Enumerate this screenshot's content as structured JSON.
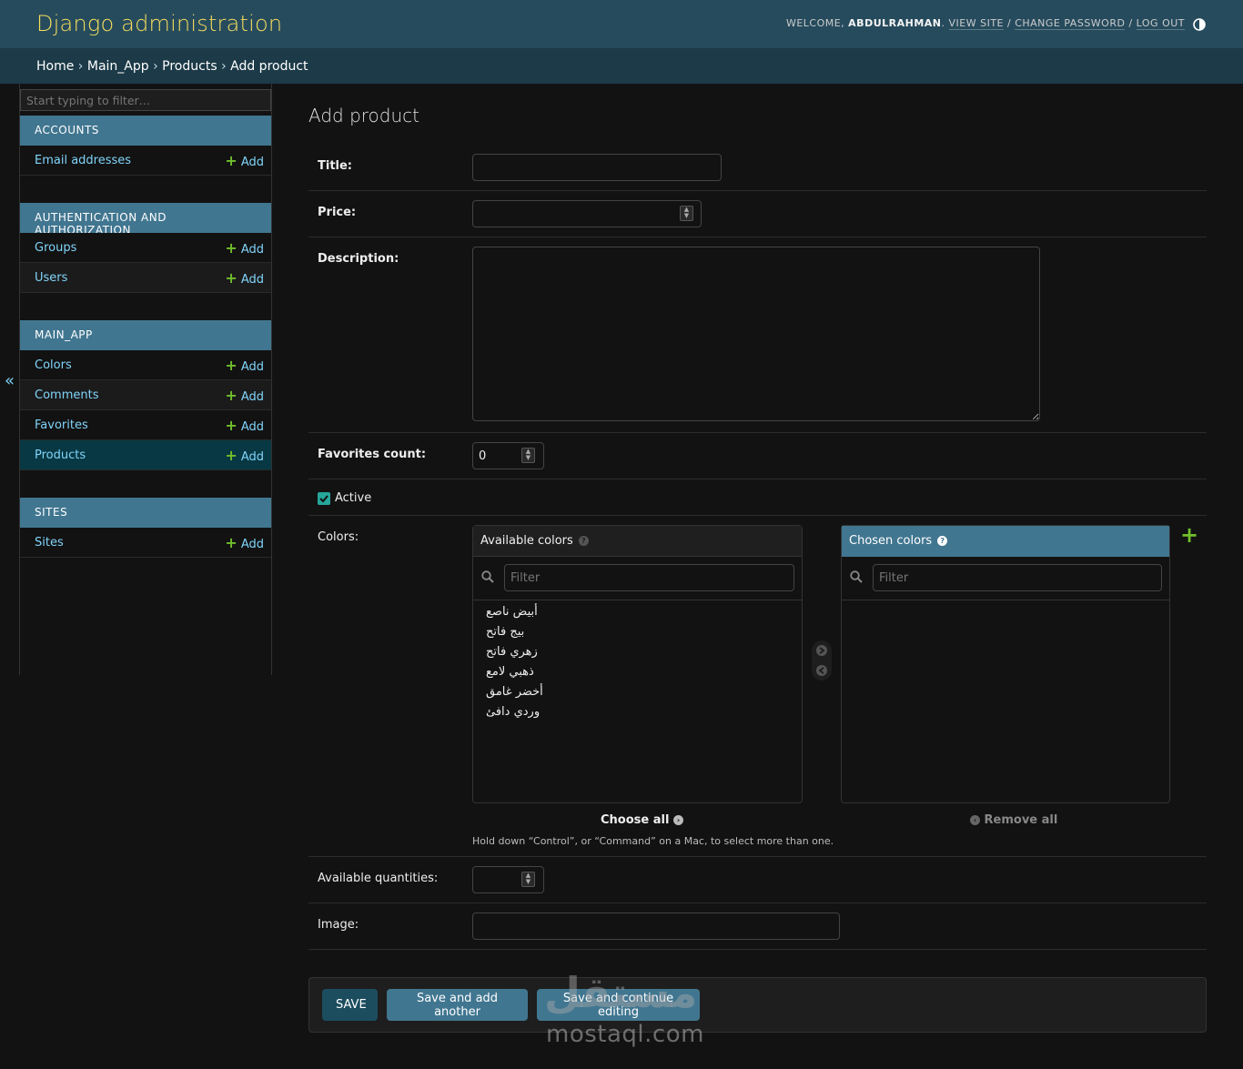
{
  "header": {
    "brand": "Django administration",
    "welcome": "WELCOME, ",
    "username": "ABDULRAHMAN",
    "view_site": "VIEW SITE",
    "change_password": "CHANGE PASSWORD",
    "log_out": "LOG OUT",
    "theme_icon": "contrast-icon"
  },
  "breadcrumb": {
    "home": "Home",
    "app": "Main_App",
    "model": "Products",
    "current": "Add product",
    "separator": "›"
  },
  "sidebar": {
    "filter_placeholder": "Start typing to filter…",
    "collapse_glyph": "«",
    "add_label": "Add",
    "modules": [
      {
        "caption": "ACCOUNTS",
        "models": [
          "Email addresses"
        ]
      },
      {
        "caption": "AUTHENTICATION AND AUTHORIZATION",
        "models": [
          "Groups",
          "Users"
        ]
      },
      {
        "caption": "MAIN_APP",
        "models": [
          "Colors",
          "Comments",
          "Favorites",
          "Products"
        ]
      },
      {
        "caption": "SITES",
        "models": [
          "Sites"
        ]
      }
    ],
    "selected_model": "Products"
  },
  "form": {
    "title": "Add product",
    "fields": {
      "title_label": "Title:",
      "price_label": "Price:",
      "description_label": "Description:",
      "favorites_label": "Favorites count:",
      "favorites_value": "0",
      "active_label": "Active",
      "active_checked": true,
      "colors_label": "Colors:",
      "quantities_label": "Available quantities:",
      "image_label": "Image:"
    },
    "colors_widget": {
      "available_title": "Available colors",
      "chosen_title": "Chosen colors",
      "filter_placeholder": "Filter",
      "available_options": [
        "أبيض ناصع",
        "بيج فاتح",
        "زهري فاتح",
        "ذهبي لامع",
        "أخضر غامق",
        "وردي دافئ"
      ],
      "chosen_options": [],
      "choose_all": "Choose all",
      "remove_all": "Remove all",
      "help": "Hold down “Control”, or “Command” on a Mac, to select more than one."
    },
    "buttons": {
      "save": "SAVE",
      "save_add_another": "Save and add another",
      "save_continue": "Save and continue editing"
    }
  },
  "watermark": {
    "logo_text": "مستقل",
    "url_text": "mostaql.com"
  },
  "colors": {
    "header_bg": "#264b5d",
    "breadcrumb_bg": "#1c3a48",
    "module_caption_bg": "#417690",
    "brand_text": "#f5dd5d",
    "link": "#81d4fa",
    "add_plus": "#70bf2b",
    "page_bg": "#121212"
  }
}
